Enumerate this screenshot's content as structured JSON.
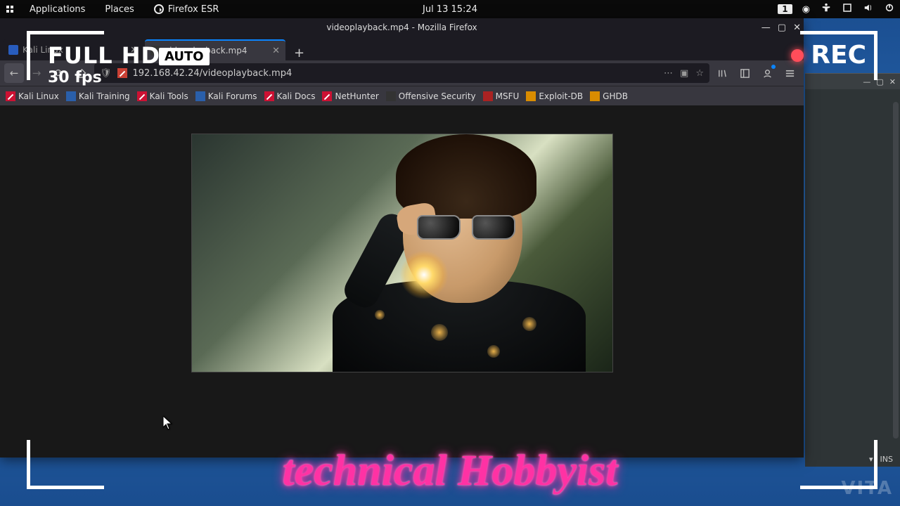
{
  "topbar": {
    "applications": "Applications",
    "places": "Places",
    "app_label": "Firefox ESR",
    "clock": "Jul 13  15:24",
    "workspace": "1"
  },
  "bgwin": {
    "status_ins": "INS"
  },
  "firefox": {
    "window_title": "videoplayback.mp4 - Mozilla Firefox",
    "tabs": [
      {
        "label": "Kali Linux"
      },
      {
        "label": "videoplayback.mp4"
      }
    ],
    "url": "192.168.42.24/videoplayback.mp4",
    "bookmarks": [
      "Kali Linux",
      "Kali Training",
      "Kali Tools",
      "Kali Forums",
      "Kali Docs",
      "NetHunter",
      "Offensive Security",
      "MSFU",
      "Exploit-DB",
      "GHDB"
    ]
  },
  "overlay": {
    "hd_line1": "FULL HD",
    "hd_line2": "30 fps",
    "auto": "AUTO",
    "rec": "REC",
    "channel": "technical Hobbyist",
    "watermark": "VITA"
  }
}
